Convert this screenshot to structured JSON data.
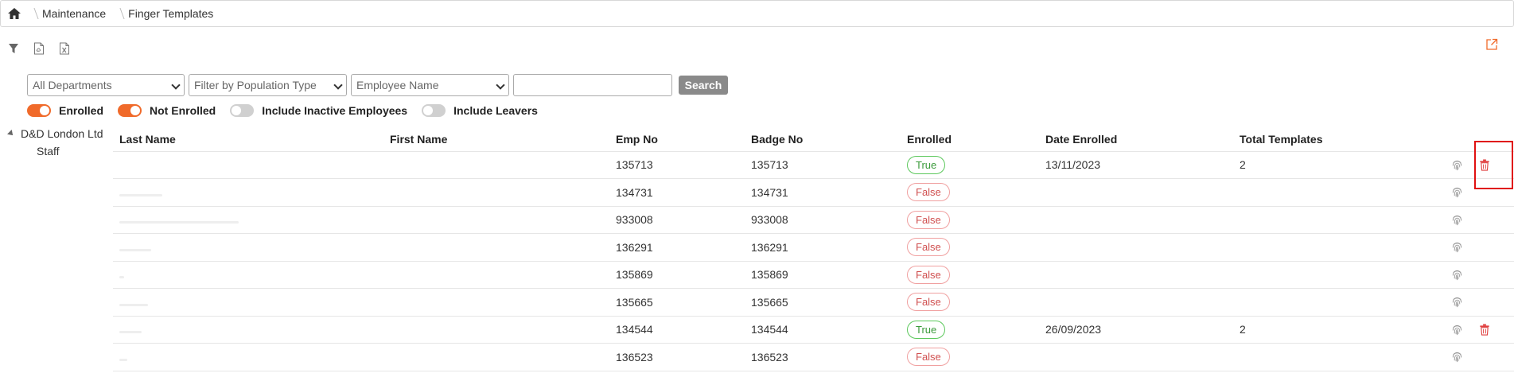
{
  "breadcrumb": {
    "items": [
      "Maintenance",
      "Finger Templates"
    ]
  },
  "toolbar": {
    "icons": [
      "filter-icon",
      "pdf-icon",
      "excel-icon"
    ]
  },
  "filters": {
    "department": "All Departments",
    "population": "Filter by Population Type",
    "field": "Employee Name",
    "search_value": "",
    "search_label": "Search"
  },
  "toggles": [
    {
      "label": "Enrolled",
      "on": true
    },
    {
      "label": "Not Enrolled",
      "on": true
    },
    {
      "label": "Include Inactive Employees",
      "on": false
    },
    {
      "label": "Include Leavers",
      "on": false
    }
  ],
  "tree": {
    "root": "D&D London Ltd",
    "child": "Staff"
  },
  "table": {
    "headers": [
      "Last Name",
      "First Name",
      "Emp No",
      "Badge No",
      "Enrolled",
      "Date Enrolled",
      "Total Templates"
    ],
    "rows": [
      {
        "emp": "135713",
        "badge": "135713",
        "enrolled": "True",
        "date": "13/11/2023",
        "templates": "2",
        "trash": true
      },
      {
        "emp": "134731",
        "badge": "134731",
        "enrolled": "False",
        "date": "",
        "templates": "",
        "trash": false
      },
      {
        "emp": "933008",
        "badge": "933008",
        "enrolled": "False",
        "date": "",
        "templates": "",
        "trash": false
      },
      {
        "emp": "136291",
        "badge": "136291",
        "enrolled": "False",
        "date": "",
        "templates": "",
        "trash": false
      },
      {
        "emp": "135869",
        "badge": "135869",
        "enrolled": "False",
        "date": "",
        "templates": "",
        "trash": false
      },
      {
        "emp": "135665",
        "badge": "135665",
        "enrolled": "False",
        "date": "",
        "templates": "",
        "trash": false
      },
      {
        "emp": "134544",
        "badge": "134544",
        "enrolled": "True",
        "date": "26/09/2023",
        "templates": "2",
        "trash": true
      },
      {
        "emp": "136523",
        "badge": "136523",
        "enrolled": "False",
        "date": "",
        "templates": "",
        "trash": false
      }
    ]
  },
  "colors": {
    "accent": "#f06a2a",
    "delete": "#e04040",
    "highlight": "#e01010"
  }
}
